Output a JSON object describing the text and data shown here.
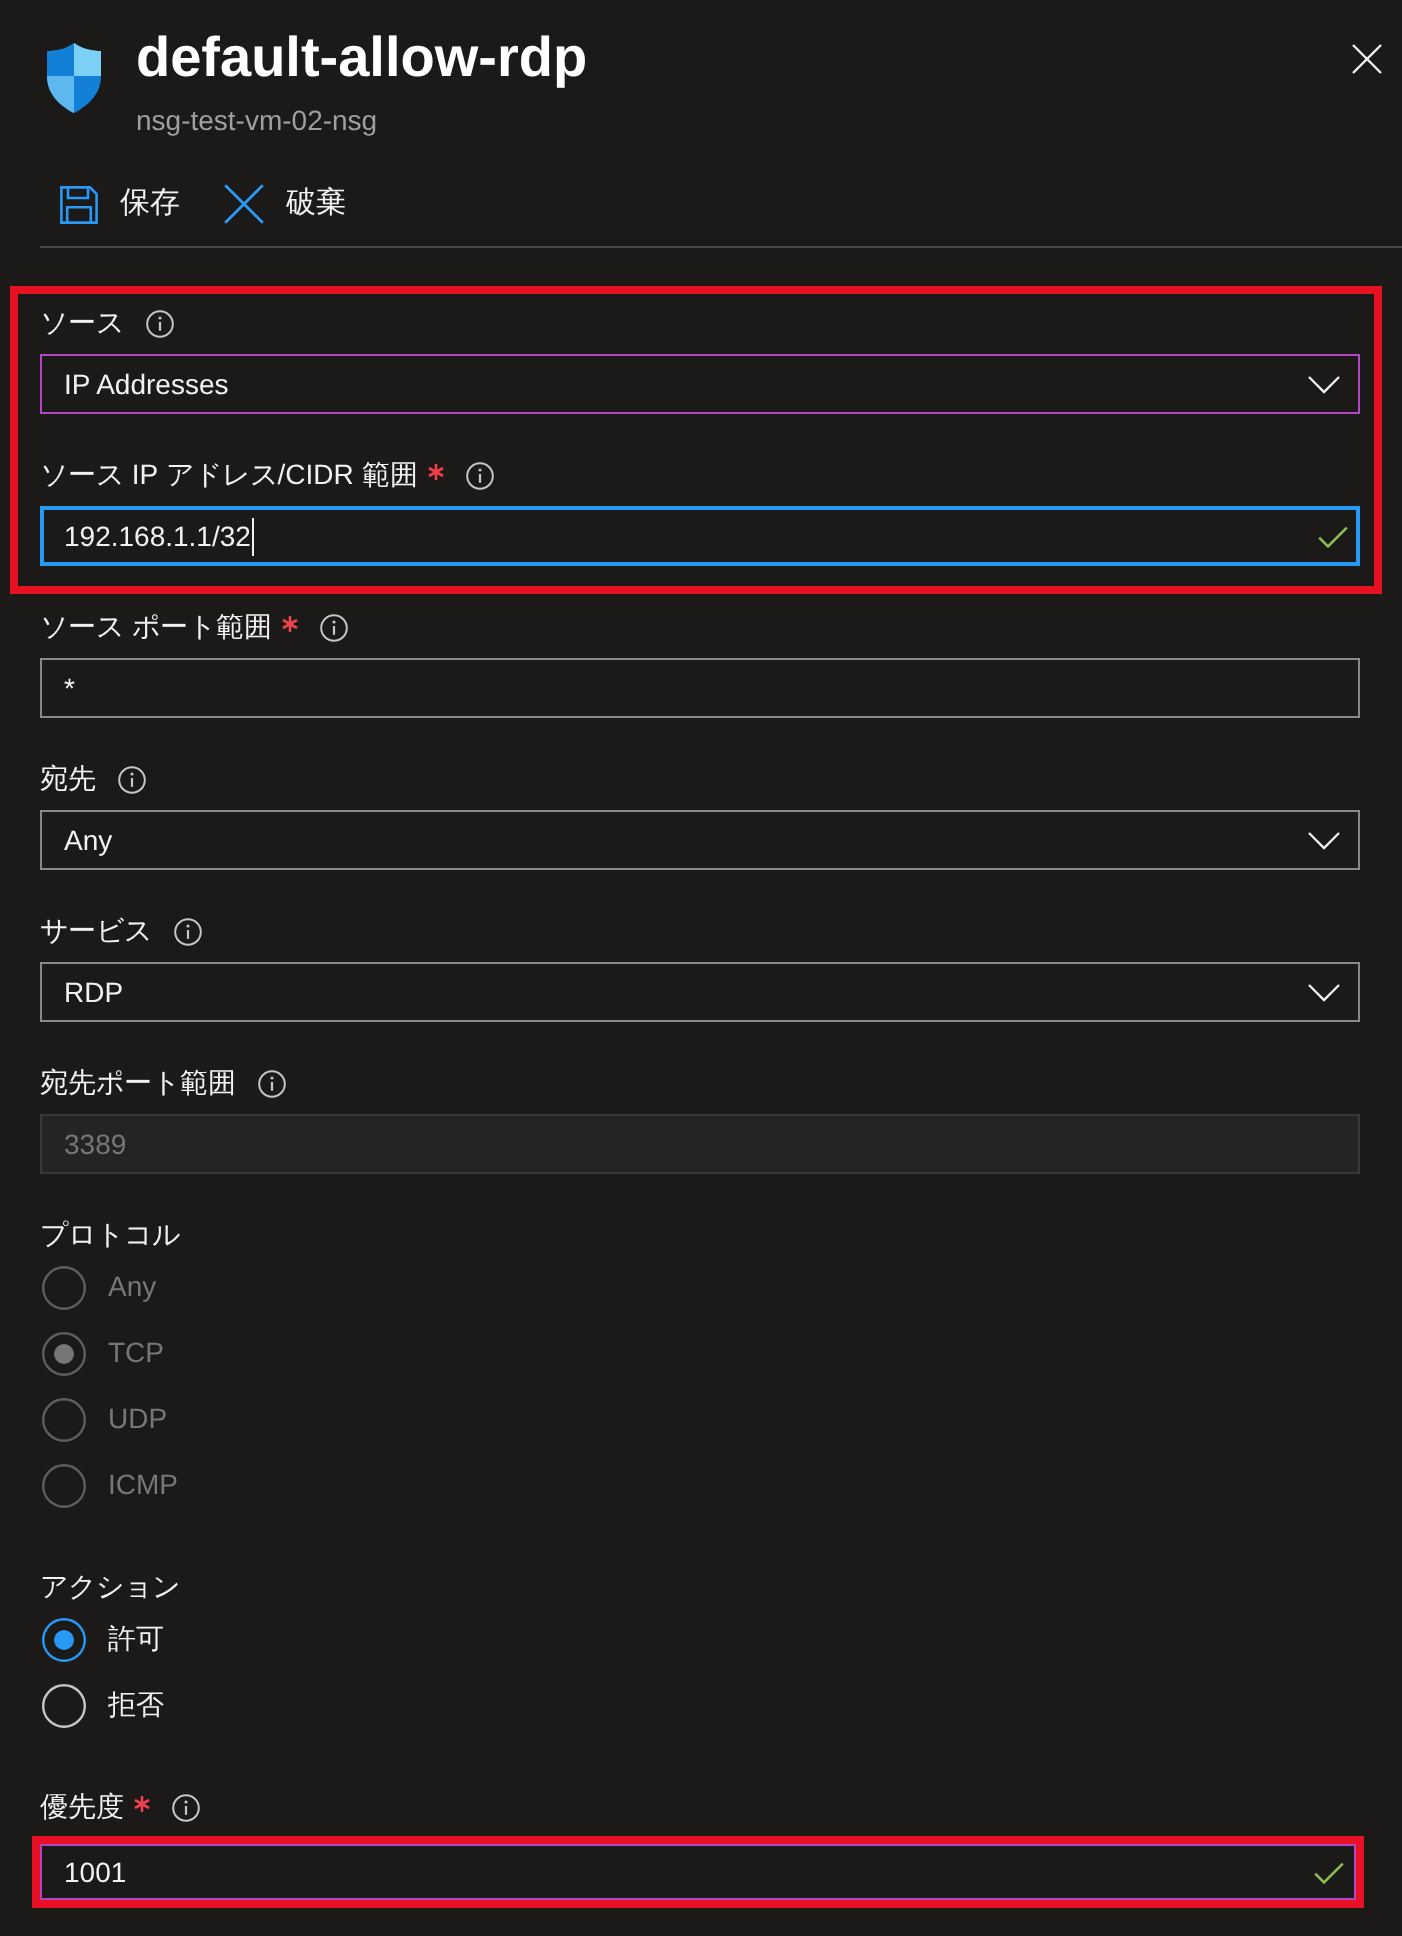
{
  "header": {
    "title": "default-allow-rdp",
    "subtitle": "nsg-test-vm-02-nsg"
  },
  "toolbar": [
    {
      "kind": "save",
      "label": "保存"
    },
    {
      "kind": "discard",
      "label": "破棄"
    }
  ],
  "groups": [
    {
      "highlighted": true,
      "fields": [
        {
          "kind": "dropdown",
          "label": "ソース",
          "required": false,
          "info": true,
          "value": "IP Addresses",
          "hovered": true,
          "focused": false,
          "disabled": false,
          "highlighted": false
        },
        {
          "kind": "text",
          "label": "ソース IP アドレス/CIDR 範囲",
          "required": true,
          "info": true,
          "value": "192.168.1.1/32",
          "hovered": false,
          "focused": true,
          "disabled": false,
          "valid": true,
          "highlighted": false
        }
      ]
    },
    {
      "highlighted": false,
      "fields": [
        {
          "kind": "text",
          "label": "ソース ポート範囲",
          "required": true,
          "info": true,
          "value": "*",
          "hovered": false,
          "focused": false,
          "disabled": false,
          "valid": false,
          "highlighted": false
        },
        {
          "kind": "dropdown",
          "label": "宛先",
          "required": false,
          "info": true,
          "value": "Any",
          "hovered": false,
          "focused": false,
          "disabled": false,
          "highlighted": false
        },
        {
          "kind": "dropdown",
          "label": "サービス",
          "required": false,
          "info": true,
          "value": "RDP",
          "hovered": false,
          "focused": false,
          "disabled": false,
          "highlighted": false
        },
        {
          "kind": "text",
          "label": "宛先ポート範囲",
          "required": false,
          "info": true,
          "value": "3389",
          "hovered": false,
          "focused": false,
          "disabled": true,
          "valid": false,
          "highlighted": false
        },
        {
          "kind": "radio",
          "label": "プロトコル",
          "required": false,
          "info": false,
          "disabled": true,
          "highlighted": false,
          "options": [
            {
              "label": "Any",
              "selected": false
            },
            {
              "label": "TCP",
              "selected": true
            },
            {
              "label": "UDP",
              "selected": false
            },
            {
              "label": "ICMP",
              "selected": false
            }
          ]
        },
        {
          "kind": "radio",
          "label": "アクション",
          "required": false,
          "info": false,
          "disabled": false,
          "highlighted": false,
          "options": [
            {
              "label": "許可",
              "selected": true
            },
            {
              "label": "拒否",
              "selected": false
            }
          ]
        }
      ]
    },
    {
      "highlighted": false,
      "fields": [
        {
          "kind": "text",
          "label": "優先度",
          "required": true,
          "info": true,
          "value": "1001",
          "hovered": true,
          "focused": false,
          "disabled": false,
          "valid": true,
          "highlighted": true
        }
      ]
    }
  ]
}
